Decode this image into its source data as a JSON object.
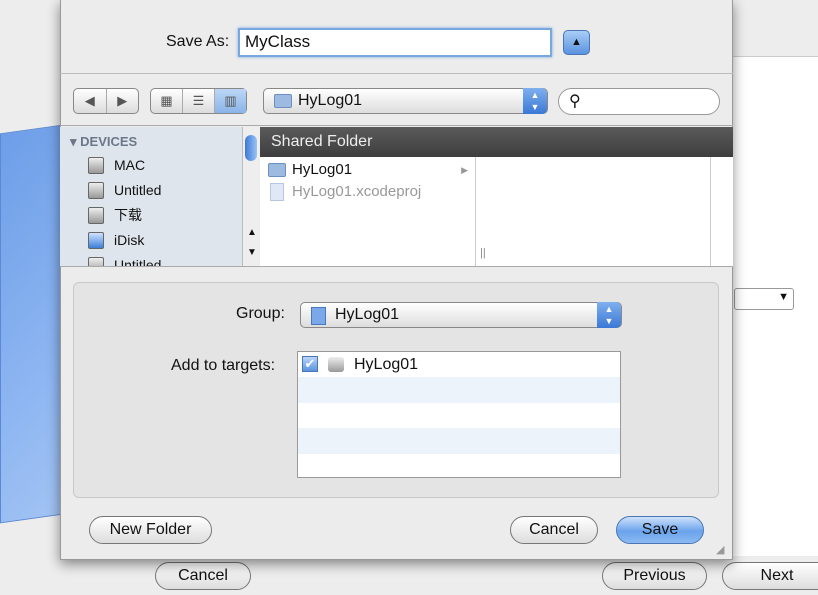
{
  "save_as": {
    "label": "Save As:",
    "value": "MyClass"
  },
  "toolbar": {
    "location": "HyLog01",
    "search_placeholder": ""
  },
  "sidebar": {
    "section": "DEVICES",
    "items": [
      {
        "label": "MAC",
        "icon": "hard-disk-icon"
      },
      {
        "label": "Untitled",
        "icon": "hard-disk-icon"
      },
      {
        "label": "下载",
        "icon": "hard-disk-icon"
      },
      {
        "label": "iDisk",
        "icon": "idisk-icon"
      },
      {
        "label": "Untitled",
        "icon": "hard-disk-icon"
      }
    ]
  },
  "browser": {
    "header": "Shared Folder",
    "column1": [
      {
        "label": "HyLog01",
        "type": "folder"
      },
      {
        "label": "HyLog01.xcodeproj",
        "type": "file",
        "disabled": true
      }
    ]
  },
  "accessory": {
    "group_label": "Group:",
    "group_value": "HyLog01",
    "targets_label": "Add to targets:",
    "targets": [
      {
        "label": "HyLog01",
        "checked": true
      }
    ]
  },
  "buttons": {
    "new_folder": "New Folder",
    "cancel": "Cancel",
    "save": "Save"
  },
  "background_window": {
    "cancel": "Cancel",
    "previous": "Previous",
    "next": "Next"
  },
  "colors": {
    "accent": "#6aa3ec",
    "header": "#4a4a4a",
    "sidebar": "#dfe5ed"
  }
}
